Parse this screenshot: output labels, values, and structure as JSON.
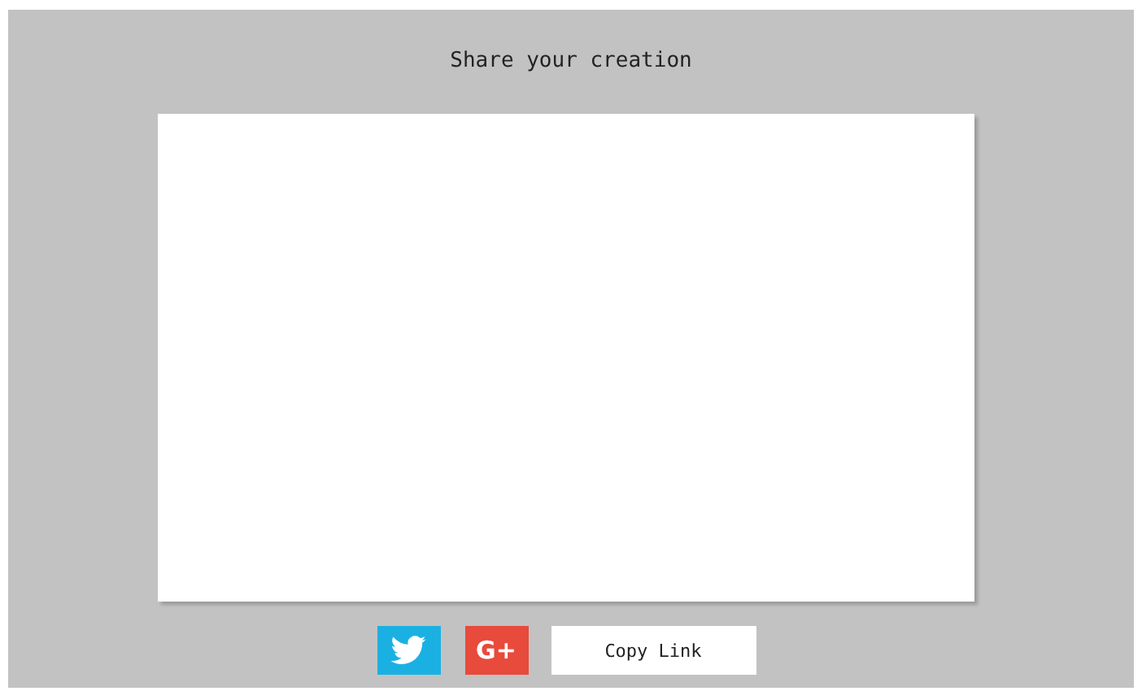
{
  "dialog": {
    "title": "Share your creation"
  },
  "share_buttons": [
    {
      "kind": "twitter"
    },
    {
      "kind": "google",
      "label": "G+"
    }
  ],
  "copy_button": {
    "label": "Copy Link"
  }
}
